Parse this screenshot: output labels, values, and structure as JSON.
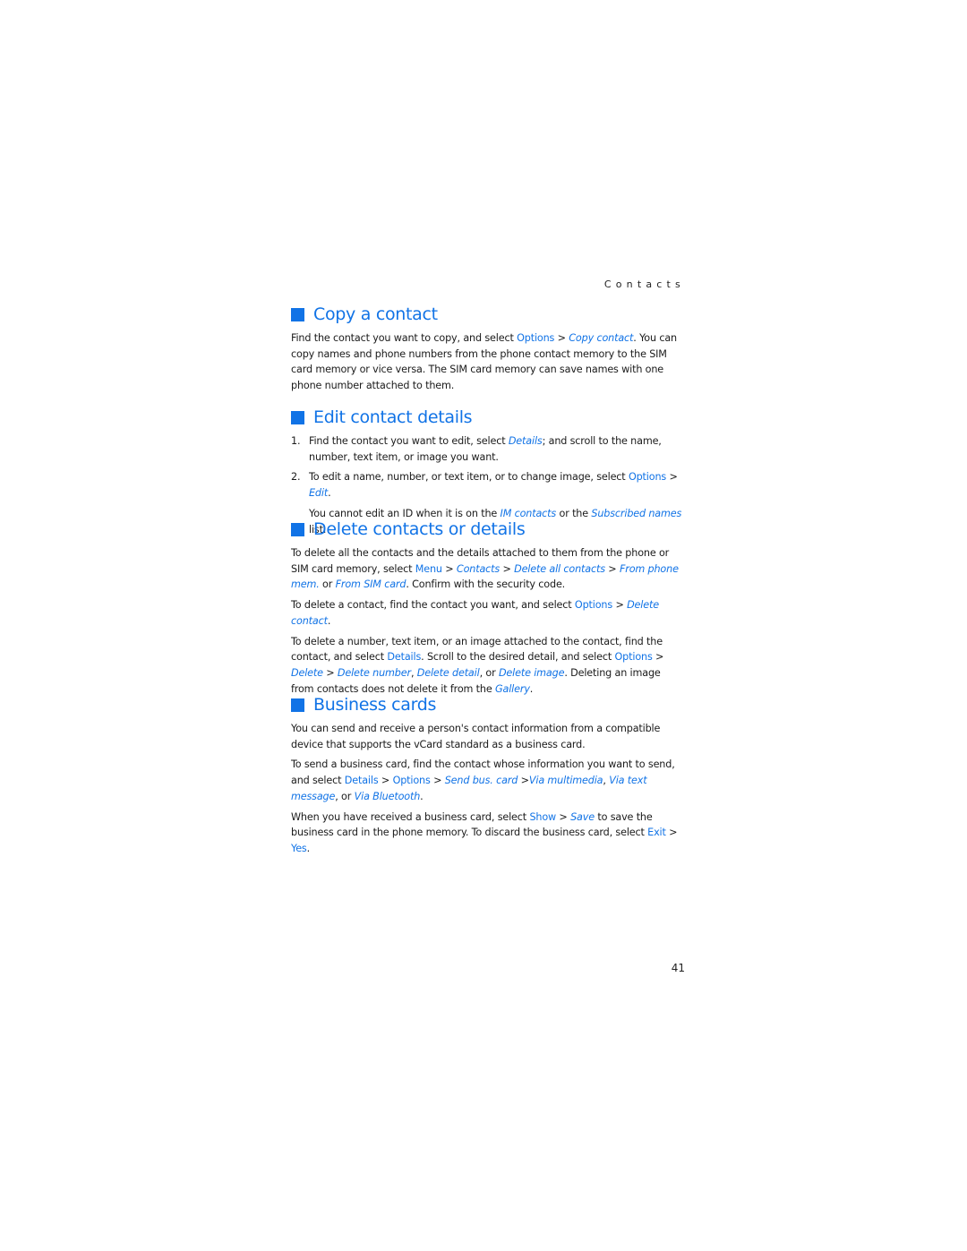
{
  "running_head": "Contacts",
  "page_number": "41",
  "accent_color": "#1173e6",
  "sections": [
    {
      "title": "Copy a contact",
      "paragraphs": [
        {
          "t1": "Find the contact you want to copy, and select ",
          "b1": "Options",
          "t2": " > ",
          "i1": "Copy contact",
          "t3": ". You can copy names and phone numbers from the phone contact memory to the SIM card memory or vice versa. The SIM card memory can save names with one phone number attached to them."
        }
      ]
    },
    {
      "title": "Edit contact details",
      "steps": [
        {
          "num": "1.",
          "t1": "Find the contact you want to edit, select ",
          "i1": "Details",
          "t2": "; and scroll to the name, number, text item, or image you want."
        },
        {
          "num": "2.",
          "t1": "To edit a name, number, or text item, or to change image, select ",
          "b1": "Options",
          "t2": " > ",
          "i1": "Edit",
          "t3": "."
        }
      ],
      "note": {
        "t1": "You cannot edit an ID when it is on the ",
        "i1": "IM contacts",
        "t2": " or the ",
        "i2": "Subscribed names",
        "t3": " list."
      }
    },
    {
      "title": "Delete contacts or details",
      "paragraphs": [
        {
          "t1": "To delete all the contacts and the details attached to them from the phone or SIM card memory, select ",
          "b1": "Menu",
          "t2": " > ",
          "i1": "Contacts",
          "t3": " > ",
          "i2": "Delete all contacts",
          "t4": " > ",
          "i3": "From phone mem.",
          "t5": " or ",
          "i4": "From SIM card",
          "t6": ". Confirm with the security code."
        },
        {
          "t1": "To delete a contact, find the contact you want, and select ",
          "b1": "Options",
          "t2": " > ",
          "i1": "Delete contact",
          "t3": "."
        },
        {
          "t1": "To delete a number, text item, or an image attached to the contact, find the contact, and select ",
          "b1": "Details",
          "t2": ". Scroll to the desired detail, and select ",
          "b2": "Options",
          "t3": " > ",
          "i1": "Delete",
          "t4": " > ",
          "i2": "Delete number",
          "t5": ", ",
          "i3": "Delete detail",
          "t6": ", or ",
          "i4": "Delete image",
          "t7": ". Deleting an image from contacts does not delete it from the ",
          "i5": "Gallery",
          "t8": "."
        }
      ]
    },
    {
      "title": "Business cards",
      "paragraphs": [
        {
          "t1": "You can send and receive a person's contact information from a compatible device that supports the vCard standard as a business card."
        },
        {
          "t1": "To send a business card, find the contact whose information you want to send, and select ",
          "b1": "Details",
          "t2": " > ",
          "b2": "Options",
          "t3": " > ",
          "i1": "Send bus. card",
          "t4": " >",
          "i2": "Via multimedia",
          "t5": ", ",
          "i3": "Via text message",
          "t6": ", or ",
          "i4": "Via Bluetooth",
          "t7": "."
        },
        {
          "t1": "When you have received a business card, select ",
          "b1": "Show",
          "t2": " > ",
          "i1": "Save",
          "t3": " to save the business card in the phone memory. To discard the business card, select ",
          "b2": "Exit",
          "t4": " > ",
          "b3": "Yes",
          "t5": "."
        }
      ]
    }
  ]
}
